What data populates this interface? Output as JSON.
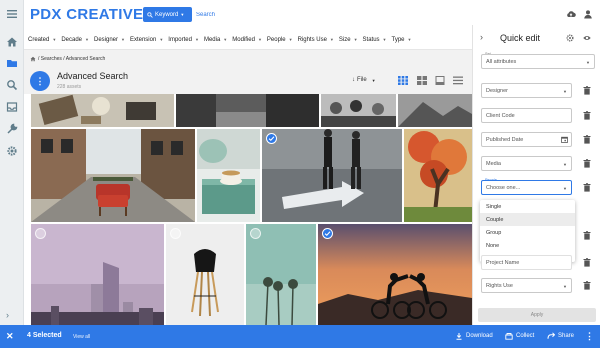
{
  "app": {
    "logo": "PDX CREATIVE"
  },
  "header": {
    "keyword_button": "Keyword",
    "search_placeholder": "Search"
  },
  "filters": [
    "Created",
    "Decade",
    "Designer",
    "Extension",
    "Imported",
    "Media",
    "Modified",
    "People",
    "Rights Use",
    "Size",
    "Status",
    "Type"
  ],
  "search": {
    "breadcrumb": "/ Searches / Advanced Search",
    "title": "Advanced Search",
    "count": "228 assets",
    "sort_label": "File"
  },
  "tiles": [
    {
      "name": "tile-desk-flatlay",
      "selected": false
    },
    {
      "name": "tile-city-street-bw",
      "selected": false
    },
    {
      "name": "tile-crowd-bw",
      "selected": false
    },
    {
      "name": "tile-mountain-bw",
      "selected": false
    },
    {
      "name": "tile-red-chair-street",
      "selected": false
    },
    {
      "name": "tile-tea-cup",
      "selected": false
    },
    {
      "name": "tile-couple-arrow",
      "selected": true
    },
    {
      "name": "tile-autumn-tree",
      "selected": false
    },
    {
      "name": "tile-skyscraper",
      "selected": false
    },
    {
      "name": "tile-black-chair",
      "selected": false
    },
    {
      "name": "tile-palm-trees",
      "selected": false
    },
    {
      "name": "tile-cyclists-sunset",
      "selected": true
    }
  ],
  "panel": {
    "title": "Quick edit",
    "set_label": "Set",
    "set_value": "All attributes",
    "fields": [
      {
        "value": "Designer",
        "type": "select"
      },
      {
        "value": "Client Code",
        "type": "text"
      },
      {
        "value": "Published Date",
        "type": "date"
      },
      {
        "value": "Media",
        "type": "select"
      }
    ],
    "people": {
      "label": "People",
      "placeholder": "Choose one..."
    },
    "people_options": [
      "Single",
      "Couple",
      "Group",
      "None"
    ],
    "people_highlighted": "Couple",
    "project_name": "Project Name",
    "rights_use": "Rights Use",
    "apply_label": "Apply"
  },
  "selection_bar": {
    "count_label": "4 Selected",
    "view_all": "View all",
    "actions": [
      {
        "label": "Download",
        "icon": "download-icon"
      },
      {
        "label": "Collect",
        "icon": "collect-icon"
      },
      {
        "label": "Share",
        "icon": "share-icon"
      }
    ]
  },
  "colors": {
    "accent": "#2f79e6",
    "rail": "#eceff1",
    "header_band": "#f2f2f2"
  }
}
